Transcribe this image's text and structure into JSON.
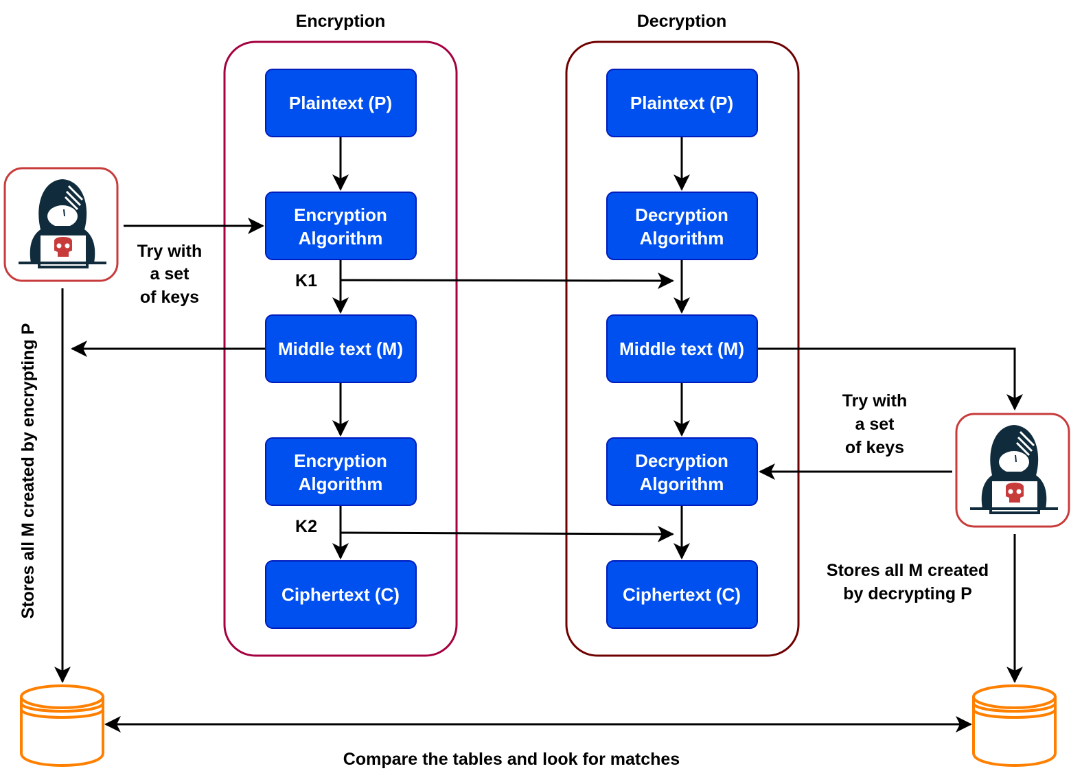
{
  "titles": {
    "encryption": "Encryption",
    "decryption": "Decryption"
  },
  "encryption_column": {
    "plaintext": "Plaintext (P)",
    "alg1": [
      "Encryption",
      "Algorithm"
    ],
    "middle": "Middle text (M)",
    "alg2": [
      "Encryption",
      "Algorithm"
    ],
    "ciphertext": "Ciphertext (C)",
    "k1": "K1",
    "k2": "K2"
  },
  "decryption_column": {
    "plaintext": "Plaintext (P)",
    "alg1": [
      "Decryption",
      "Algorithm"
    ],
    "middle": "Middle text (M)",
    "alg2": [
      "Decryption",
      "Algorithm"
    ],
    "ciphertext": "Ciphertext (C)"
  },
  "left_attacker": {
    "icon": "hacker-icon",
    "try_label": [
      "Try with",
      "a set",
      "of keys"
    ],
    "store_label": "Stores all M created by encrypting P"
  },
  "right_attacker": {
    "icon": "hacker-icon",
    "try_label": [
      "Try with",
      "a set",
      "of keys"
    ],
    "store_label": [
      "Stores all M created",
      "by decrypting P"
    ]
  },
  "compare_label": "Compare the tables and look for matches",
  "colors": {
    "box_fill": "#0050ef",
    "box_stroke": "#001dbc",
    "enc_container": "#a50040",
    "dec_container": "#6f0000",
    "database": "#ff8000",
    "hacker_frame": "#c73b3b",
    "hacker_body": "#0f2b3c"
  }
}
